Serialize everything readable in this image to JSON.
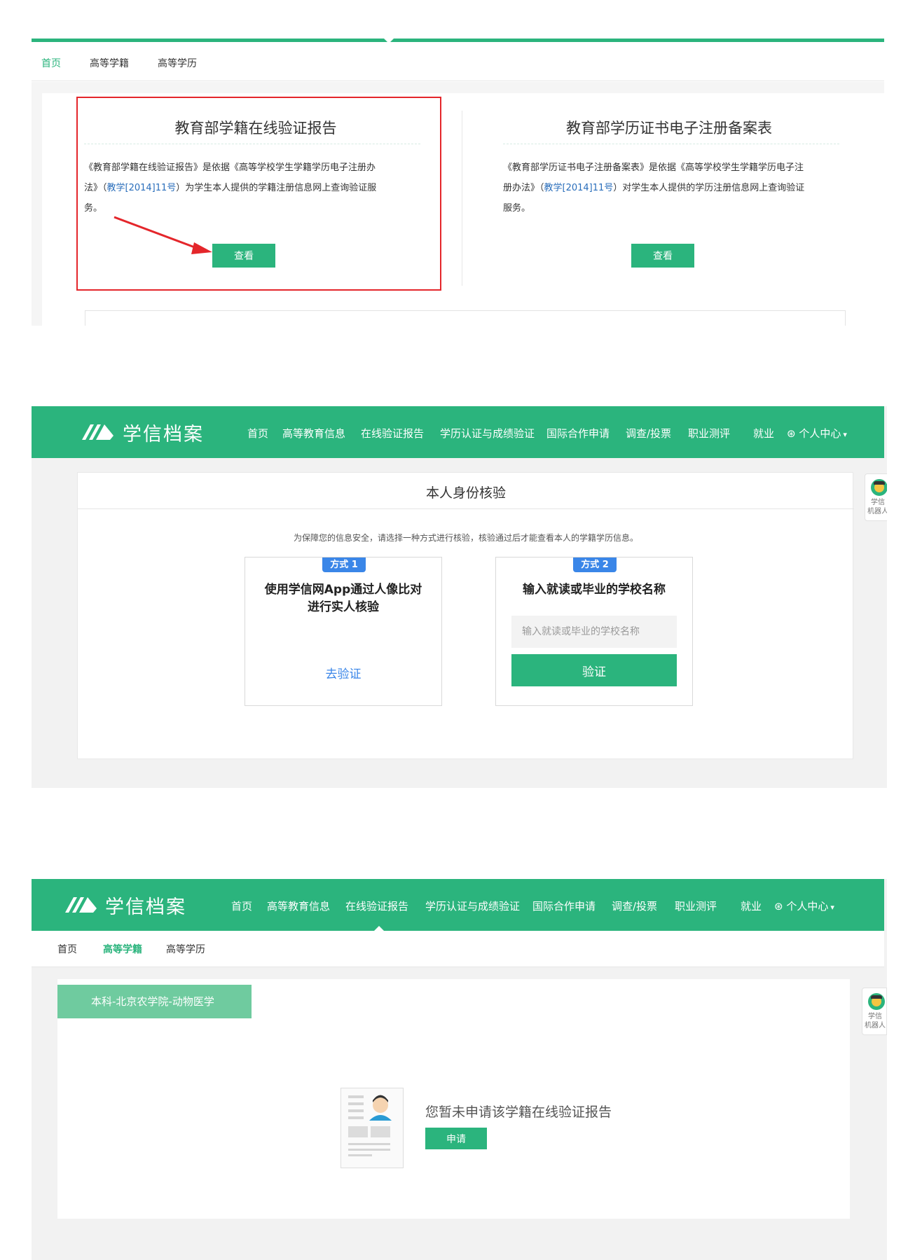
{
  "panel1": {
    "subnav": [
      "首页",
      "高等学籍",
      "高等学历"
    ],
    "card_left": {
      "title": "教育部学籍在线验证报告",
      "desc_lines": [
        "《教育部学籍在线验证报告》是依据《高等学校学生学籍学历电子注册办",
        "法》（",
        "教学[2014]11号",
        "）为学生本人提供的学籍注册信息网上查询验证服",
        "务。"
      ],
      "button": "查看"
    },
    "card_right": {
      "title": "教育部学历证书电子注册备案表",
      "desc_lines": [
        "《教育部学历证书电子注册备案表》是依据《高等学校学生学籍学历电子注",
        "册办法》（",
        "教学[2014]11号",
        "）对学生本人提供的学历注册信息网上查询验证",
        "服务。"
      ],
      "button": "查看"
    },
    "accent": "#2bb47d",
    "highlight": "#e4262b"
  },
  "header": {
    "logo_text": "学信档案",
    "nav": [
      "首页",
      "高等教育信息",
      "在线验证报告",
      "学历认证与成绩验证",
      "国际合作申请",
      "调查/投票",
      "职业测评",
      "就业"
    ],
    "user_icon": "user-circle-icon",
    "user_menu": "个人中心",
    "caret": "▾"
  },
  "panel2": {
    "title": "本人身份核验",
    "hint": "为保障您的信息安全，请选择一种方式进行核验，核验通过后才能查看本人的学籍学历信息。",
    "method1": {
      "badge": "方式 1",
      "title_line1": "使用学信网App通过人像比对",
      "title_line2": "进行实人核验",
      "link": "去验证"
    },
    "method2": {
      "badge": "方式 2",
      "title": "输入就读或毕业的学校名称",
      "input_placeholder": "输入就读或毕业的学校名称",
      "button": "验证"
    },
    "robot": {
      "line1": "学信",
      "line2": "机器人"
    }
  },
  "panel3": {
    "subnav": [
      "首页",
      "高等学籍",
      "高等学历"
    ],
    "tag": "本科-北京农学院-动物医学",
    "empty_message": "您暂未申请该学籍在线验证报告",
    "button": "申请",
    "robot": {
      "line1": "学信",
      "line2": "机器人"
    }
  }
}
